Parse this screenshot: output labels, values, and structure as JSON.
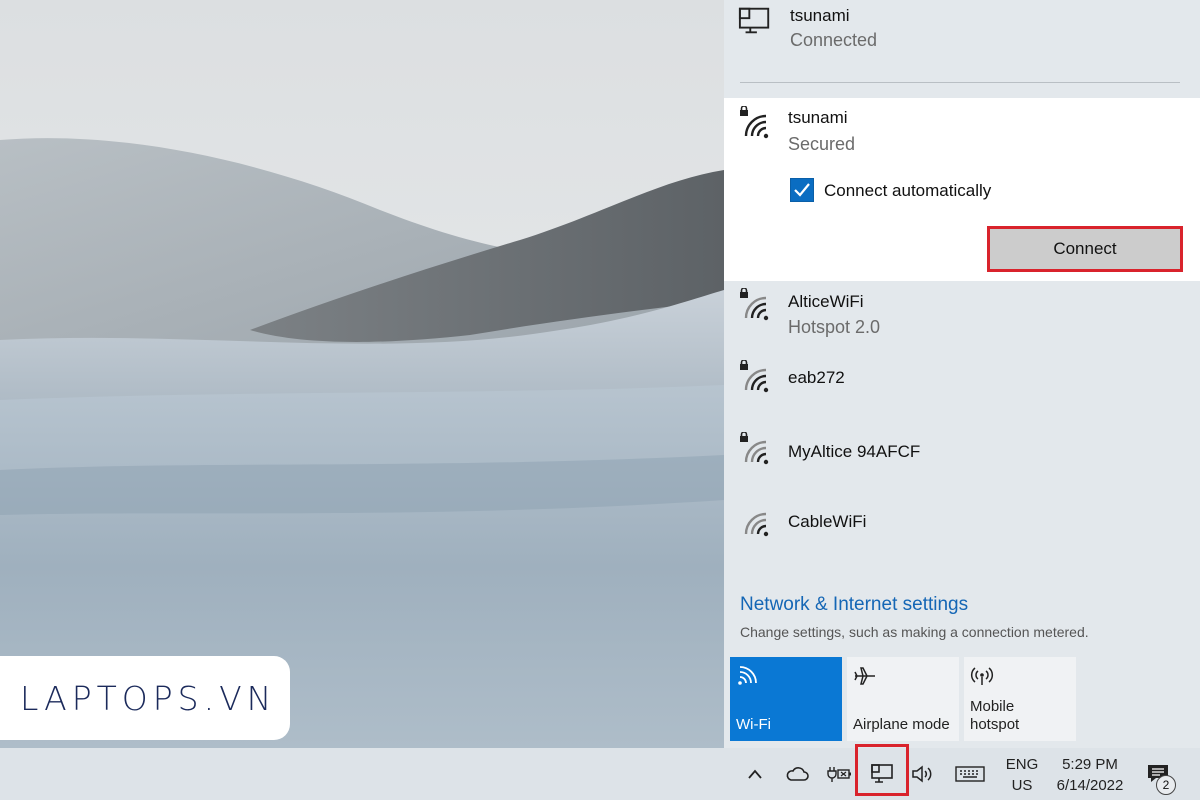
{
  "watermark": {
    "text": "LAPTOPS.VN"
  },
  "flyout": {
    "connected_network": {
      "name": "tsunami",
      "status": "Connected",
      "icon": "ethernet-monitor-icon"
    },
    "selected_network": {
      "name": "tsunami",
      "status": "Secured",
      "icon": "wifi-secured-icon",
      "auto_connect_label": "Connect automatically",
      "auto_connect_checked": true,
      "connect_label": "Connect"
    },
    "networks": [
      {
        "name": "AlticeWiFi",
        "status": "Hotspot 2.0",
        "secured": true
      },
      {
        "name": "eab272",
        "status": "",
        "secured": true
      },
      {
        "name": "MyAltice 94AFCF",
        "status": "",
        "secured": true
      },
      {
        "name": "CableWiFi",
        "status": "",
        "secured": false
      }
    ],
    "settings_link": "Network & Internet settings",
    "settings_desc": "Change settings, such as making a connection metered.",
    "quick_actions": [
      {
        "label": "Wi-Fi",
        "icon": "wifi-icon",
        "active": true
      },
      {
        "label": "Airplane mode",
        "icon": "airplane-icon",
        "active": false
      },
      {
        "label": "Mobile hotspot",
        "icon": "hotspot-icon",
        "active": false
      }
    ]
  },
  "taskbar": {
    "language_line1": "ENG",
    "language_line2": "US",
    "time": "5:29 PM",
    "date": "6/14/2022",
    "notification_count": "2",
    "tray_icons": [
      "chevron-up-icon",
      "cloud-icon",
      "battery-plug-icon",
      "network-icon",
      "volume-icon",
      "keyboard-icon",
      "notification-icon"
    ]
  },
  "colors": {
    "accent": "#0a78d4",
    "highlight_border": "#d9232c",
    "link": "#1466b5"
  }
}
